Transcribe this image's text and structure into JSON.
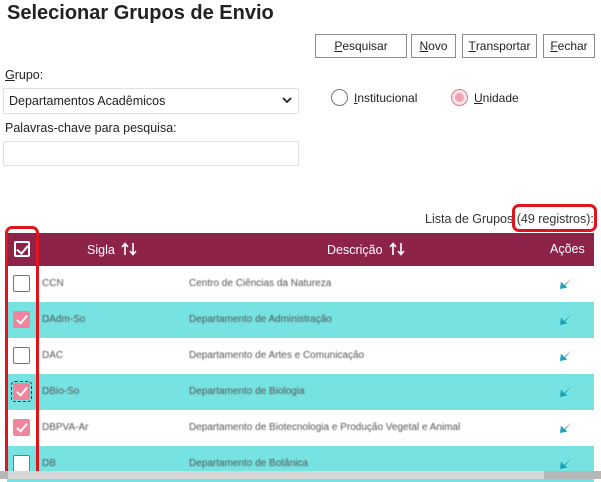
{
  "page": {
    "title": "Selecionar Grupos de Envio"
  },
  "toolbar": {
    "search": {
      "key": "P",
      "rest": "esquisar"
    },
    "new": {
      "key": "N",
      "rest": "ovo"
    },
    "transport": {
      "key": "T",
      "rest": "ransportar"
    },
    "close": {
      "key": "F",
      "rest": "echar"
    }
  },
  "form": {
    "group_label_key": "G",
    "group_label_rest": "rupo:",
    "group_selected": "Departamentos Acadêmicos",
    "keywords_label": "Palavras-chave para pesquisa:",
    "keywords_value": "",
    "radio_institutional": {
      "key": "I",
      "rest": "nstitucional",
      "checked": false
    },
    "radio_unit": {
      "key": "U",
      "rest": "nidade",
      "checked": true
    }
  },
  "list": {
    "count_label": "Lista de Grupos",
    "count_value": "(49 registros):",
    "headers": {
      "sigla": "Sigla",
      "descricao": "Descrição",
      "acoes": "Ações"
    },
    "rows": [
      {
        "sigla": "CCN",
        "descricao": "Centro de Ciências da Natureza",
        "checked": false
      },
      {
        "sigla": "DAdm-So",
        "descricao": "Departamento de Administração",
        "checked": true
      },
      {
        "sigla": "DAC",
        "descricao": "Departamento de Artes e Comunicação",
        "checked": false
      },
      {
        "sigla": "DBio-So",
        "descricao": "Departamento de Biologia",
        "checked": true
      },
      {
        "sigla": "DBPVA-Ar",
        "descricao": "Departamento de Biotecnologia e Produção Vegetal e Animal",
        "checked": true
      },
      {
        "sigla": "DB",
        "descricao": "Departamento de Botânica",
        "checked": false
      }
    ]
  },
  "colors": {
    "header_bg": "#8e2349",
    "alt_row_bg": "#76e2e2",
    "checkbox_checked": "#f2839c",
    "action_icon": "#1aa3b8",
    "highlight": "#e0141b"
  },
  "icons": {
    "sort": "sort-arrows-icon",
    "action": "select-arrow-icon",
    "header_check": "check-all-icon"
  }
}
